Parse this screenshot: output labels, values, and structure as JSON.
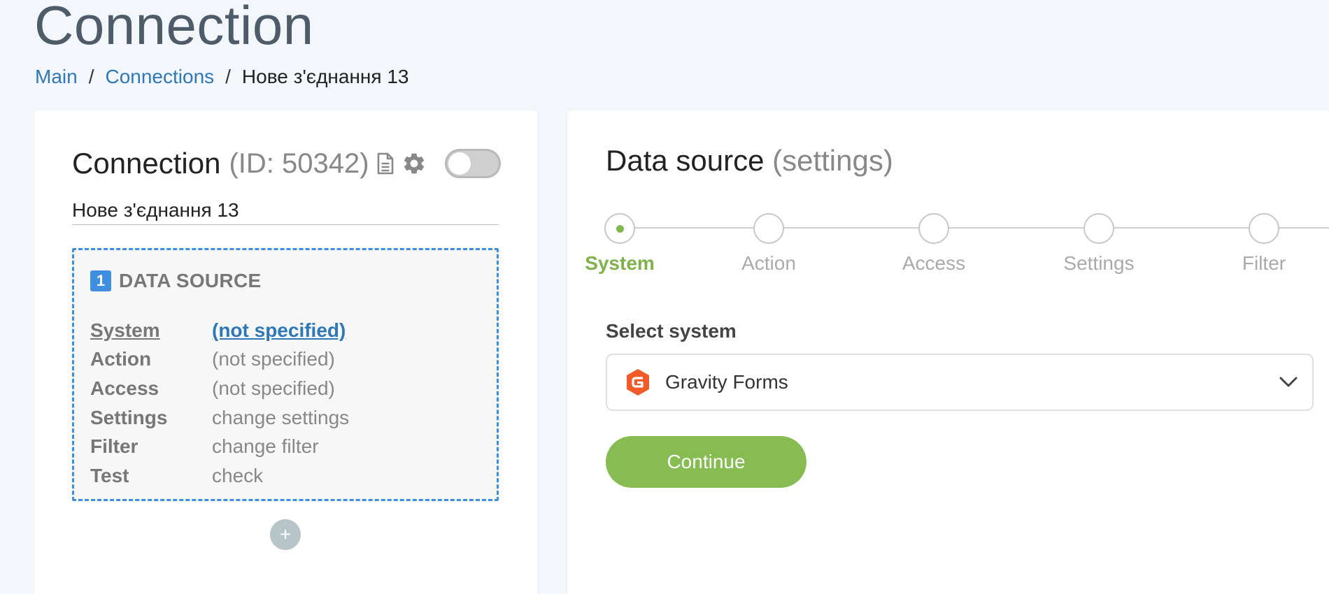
{
  "page": {
    "title": "Connection",
    "breadcrumb": [
      {
        "label": "Main"
      },
      {
        "label": "Connections"
      },
      {
        "label": "Нове з'єднання 13"
      }
    ]
  },
  "left_panel": {
    "title": "Connection",
    "id_text": "(ID: 50342)",
    "name_value": "Нове з'єднання 13",
    "toggle_state": "off",
    "data_source": {
      "number": "1",
      "title": "DATA SOURCE",
      "rows": [
        {
          "label": "System",
          "value": "(not specified)"
        },
        {
          "label": "Action",
          "value": "(not specified)"
        },
        {
          "label": "Access",
          "value": "(not specified)"
        },
        {
          "label": "Settings",
          "value": "change settings"
        },
        {
          "label": "Filter",
          "value": "change filter"
        },
        {
          "label": "Test",
          "value": "check"
        }
      ]
    },
    "add_button_label": "+"
  },
  "right_panel": {
    "title": "Data source",
    "title_muted": "(settings)",
    "steps": [
      {
        "label": "System",
        "active": true
      },
      {
        "label": "Action",
        "active": false
      },
      {
        "label": "Access",
        "active": false
      },
      {
        "label": "Settings",
        "active": false
      },
      {
        "label": "Filter",
        "active": false
      }
    ],
    "select_label": "Select system",
    "selected_system": "Gravity Forms",
    "continue_label": "Continue"
  },
  "colors": {
    "accent_blue": "#3f8fe0",
    "link_blue": "#2e78b7",
    "green": "#86bc52",
    "gravity_orange": "#f15a29"
  }
}
